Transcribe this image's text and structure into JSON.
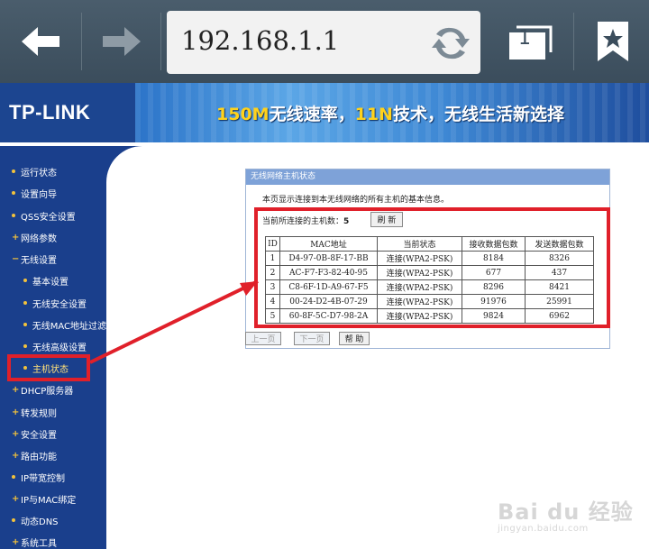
{
  "browser": {
    "url": "192.168.1.1",
    "tab_count": "1"
  },
  "banner": {
    "logo": "TP-LINK",
    "slogan_a": "150M",
    "slogan_b": "无线速率，",
    "slogan_c": "11N",
    "slogan_d": "技术，无线生活新选择"
  },
  "sidebar": {
    "items": [
      {
        "label": "运行状态"
      },
      {
        "label": "设置向导"
      },
      {
        "label": "QSS安全设置"
      },
      {
        "label": "网络参数"
      },
      {
        "label": "无线设置"
      },
      {
        "label": "基本设置"
      },
      {
        "label": "无线安全设置"
      },
      {
        "label": "无线MAC地址过滤"
      },
      {
        "label": "无线高级设置"
      },
      {
        "label": "主机状态"
      },
      {
        "label": "DHCP服务器"
      },
      {
        "label": "转发规则"
      },
      {
        "label": "安全设置"
      },
      {
        "label": "路由功能"
      },
      {
        "label": "IP带宽控制"
      },
      {
        "label": "IP与MAC绑定"
      },
      {
        "label": "动态DNS"
      },
      {
        "label": "系统工具"
      }
    ]
  },
  "panel": {
    "title": "无线网络主机状态",
    "description": "本页显示连接到本无线网络的所有主机的基本信息。",
    "count_label": "当前所连接的主机数：",
    "count_value": "5",
    "refresh_label": "刷 新",
    "headers": [
      "ID",
      "MAC地址",
      "当前状态",
      "接收数据包数",
      "发送数据包数"
    ],
    "rows": [
      [
        "1",
        "D4-97-0B-8F-17-BB",
        "连接(WPA2-PSK)",
        "8184",
        "8326"
      ],
      [
        "2",
        "AC-F7-F3-82-40-95",
        "连接(WPA2-PSK)",
        "677",
        "437"
      ],
      [
        "3",
        "C8-6F-1D-A9-67-F5",
        "连接(WPA2-PSK)",
        "8296",
        "8421"
      ],
      [
        "4",
        "00-24-D2-4B-07-29",
        "连接(WPA2-PSK)",
        "91976",
        "25991"
      ],
      [
        "5",
        "60-8F-5C-D7-98-2A",
        "连接(WPA2-PSK)",
        "9824",
        "6962"
      ]
    ],
    "prev_label": "上一页",
    "next_label": "下一页",
    "help_label": "帮 助"
  },
  "watermark": {
    "line1": "Bai du 经验",
    "line2": "jingyan.baidu.com"
  },
  "colors": {
    "sidebar": "#1a3f8c",
    "highlight": "#e0202a",
    "panel_title": "#7ea2d8"
  }
}
